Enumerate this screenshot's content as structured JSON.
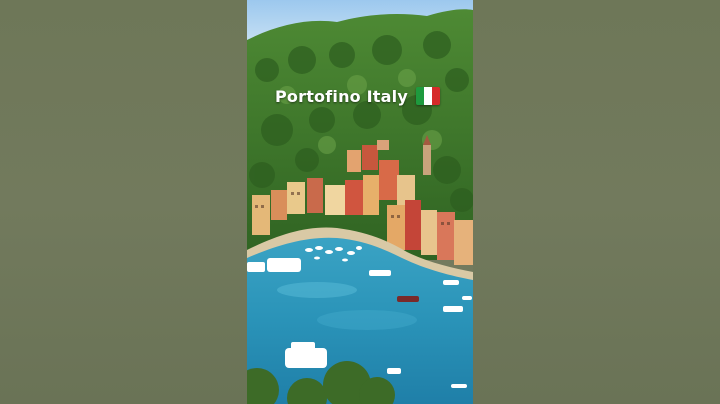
{
  "caption": {
    "text": "Portofino Italy",
    "flag_icon": "italy-flag-icon"
  },
  "colors": {
    "sea": "#2a93b8",
    "hills": "#3f7a2c",
    "sky": "#a9cfee",
    "flag_green": "#1e9a3e",
    "flag_white": "#ffffff",
    "flag_red": "#d62a2a",
    "background": "#737a5e"
  }
}
